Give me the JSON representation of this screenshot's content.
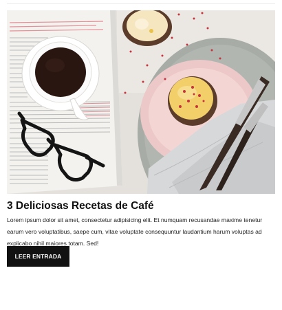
{
  "article": {
    "title": "3 Deliciosas Recetas de Café",
    "excerpt": "Lorem ipsum dolor sit amet, consectetur adipisicing elit. Et numquam recusandae maxime tenetur earum vero voluptatibus, saepe cum, vitae voluptate consequuntur laudantium harum voluptas ad explicabo nihil maiores totam. Sed!",
    "read_more_label": "LEER ENTRADA"
  },
  "image": {
    "subject": "coffee-cupcakes-table-photo"
  },
  "colors": {
    "button_bg": "#111111",
    "button_text": "#ffffff",
    "title_text": "#111111"
  }
}
